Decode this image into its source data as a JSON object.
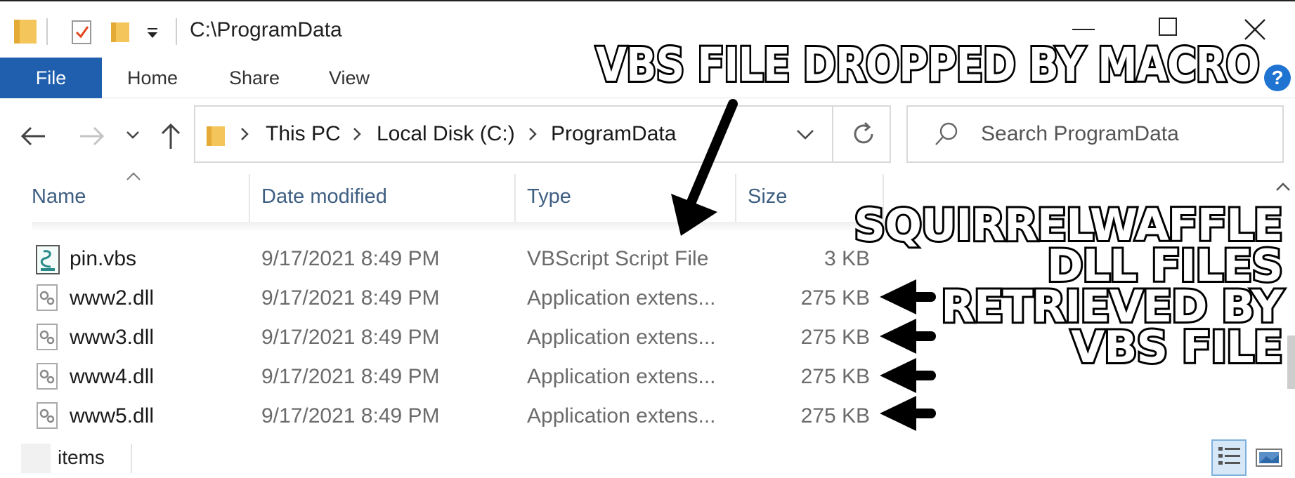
{
  "window": {
    "title": "C:\\ProgramData"
  },
  "ribbon": {
    "tabs": [
      "File",
      "Home",
      "Share",
      "View"
    ],
    "help": "?"
  },
  "address": {
    "crumbs": [
      "This PC",
      "Local Disk (C:)",
      "ProgramData"
    ]
  },
  "search": {
    "placeholder": "Search ProgramData"
  },
  "columns": [
    "Name",
    "Date modified",
    "Type",
    "Size"
  ],
  "files": [
    {
      "name": "pin.vbs",
      "date": "9/17/2021 8:49 PM",
      "type": "VBScript Script File",
      "size": "3 KB",
      "icon": "vbs-script-icon"
    },
    {
      "name": "www2.dll",
      "date": "9/17/2021 8:49 PM",
      "type": "Application extens...",
      "size": "275 KB",
      "icon": "dll-file-icon"
    },
    {
      "name": "www3.dll",
      "date": "9/17/2021 8:49 PM",
      "type": "Application extens...",
      "size": "275 KB",
      "icon": "dll-file-icon"
    },
    {
      "name": "www4.dll",
      "date": "9/17/2021 8:49 PM",
      "type": "Application extens...",
      "size": "275 KB",
      "icon": "dll-file-icon"
    },
    {
      "name": "www5.dll",
      "date": "9/17/2021 8:49 PM",
      "type": "Application extens...",
      "size": "275 KB",
      "icon": "dll-file-icon"
    }
  ],
  "status": {
    "items_text": "items"
  },
  "annotations": {
    "top": "VBS FILE DROPPED BY MACRO",
    "right": [
      "SQUIRRELWAFFLE",
      "DLL FILES",
      "RETRIEVED BY",
      "VBS FILE"
    ]
  },
  "colors": {
    "file_tab": "#1f5fae",
    "header_text": "#3f5f82",
    "help": "#1f73d1",
    "folder": "#f4c55a"
  }
}
